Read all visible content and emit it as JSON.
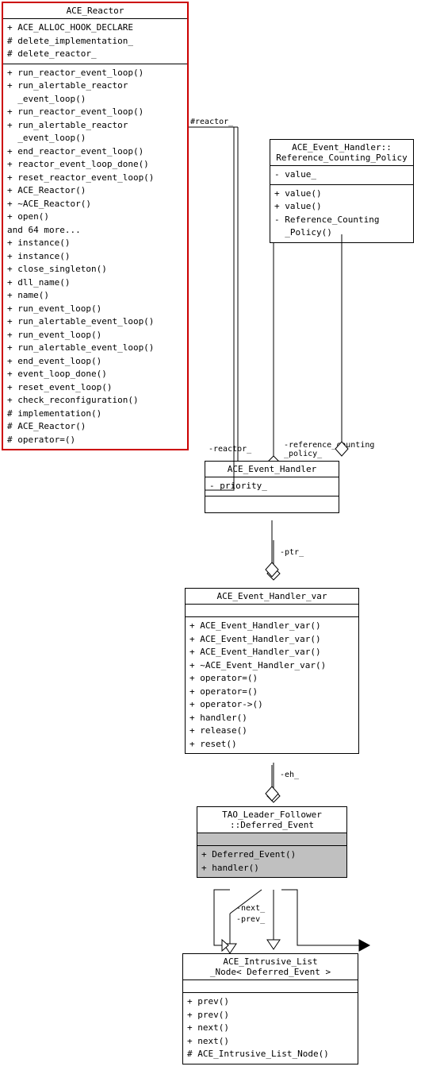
{
  "boxes": {
    "ace_reactor": {
      "title": "ACE_Reactor",
      "section1": [
        "+ ACE_ALLOC_HOOK_DECLARE",
        "# delete_implementation_",
        "# delete_reactor_"
      ],
      "section2": [
        "+ run_reactor_event_loop()",
        "+ run_alertable_reactor_event_loop()",
        "+ run_reactor_event_loop()",
        "+ run_alertable_reactor_event_loop()",
        "+ end_reactor_event_loop()",
        "+ reactor_event_loop_done()",
        "+ reset_reactor_event_loop()",
        "+ ACE_Reactor()",
        "+ ~ACE_Reactor()",
        "+ open()",
        "and 64 more...",
        "+ instance()",
        "+ instance()",
        "+ close_singleton()",
        "+ dll_name()",
        "+ name()",
        "+ run_event_loop()",
        "+ run_alertable_event_loop()",
        "+ run_event_loop()",
        "+ run_alertable_event_loop()",
        "+ end_event_loop()",
        "+ event_loop_done()",
        "+ reset_event_loop()",
        "+ check_reconfiguration()",
        "# implementation()",
        "# ACE_Reactor()",
        "# operator=()"
      ]
    },
    "ace_event_handler_rcp": {
      "title": "ACE_Event_Handler::\nReference_Counting_Policy",
      "section1": [
        "- value_"
      ],
      "section2": [
        "+ value()",
        "+ value()",
        "- Reference_Counting\n_Policy()"
      ]
    },
    "ace_event_handler": {
      "title": "ACE_Event_Handler",
      "section1": [
        "- priority_"
      ],
      "section2": []
    },
    "ace_event_handler_var": {
      "title": "ACE_Event_Handler_var",
      "section1": [],
      "section2": [
        "+ ACE_Event_Handler_var()",
        "+ ACE_Event_Handler_var()",
        "+ ACE_Event_Handler_var()",
        "+ ~ACE_Event_Handler_var()",
        "+ operator=()",
        "+ operator=()",
        "+ operator->()",
        "+ handler()",
        "+ release()",
        "+ reset()"
      ]
    },
    "tao_leader_follower": {
      "title": "TAO_Leader_Follower\n::Deferred_Event",
      "section1_shaded": true,
      "section2": [
        "+ Deferred_Event()",
        "+ handler()"
      ]
    },
    "ace_intrusive_list": {
      "title": "ACE_Intrusive_List\n_Node< Deferred_Event >",
      "section1": [],
      "section2": [
        "+ prev()",
        "+ prev()",
        "+ next()",
        "+ next()",
        "# ACE_Intrusive_List_Node()"
      ]
    }
  },
  "labels": {
    "reactor_left": "#reactor_",
    "reactor_right": "-reactor_",
    "reference_counting": "-reference_counting\n_policy_",
    "ptr": "-ptr_",
    "eh": "-eh_",
    "next": "-next_",
    "prev": "-prev_"
  },
  "colors": {
    "red_border": "#cc0000",
    "shaded": "#c0c0c0"
  }
}
